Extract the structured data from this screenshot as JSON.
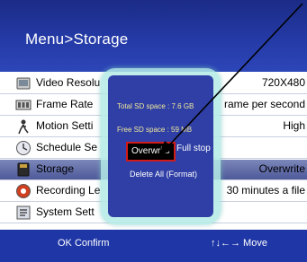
{
  "header": {
    "title": "Menu>Storage"
  },
  "menu": {
    "rows": [
      {
        "label": "Video Resolu",
        "value": "720X480"
      },
      {
        "label": "Frame Rate",
        "value": "rame per second"
      },
      {
        "label": "Motion Setti",
        "value": "High"
      },
      {
        "label": "Schedule Se",
        "value": ""
      },
      {
        "label": "Storage",
        "value": "Overwrite"
      },
      {
        "label": "Recording Le",
        "value": "30 minutes a file"
      },
      {
        "label": "System Sett",
        "value": ""
      }
    ],
    "selected_index": 4
  },
  "popup": {
    "total_sd_space": "Total SD space : 7.6 GB",
    "free_sd_space": "Free SD space : 59 MB",
    "option_overwrite": "Overwrite",
    "or_text": "or",
    "option_full_stop": "Full stop",
    "delete_all": "Delete All (Format)"
  },
  "footer": {
    "confirm": "OK Confirm",
    "move": "↑↓←→ Move"
  },
  "colors": {
    "header_blue": "#243aa6",
    "footer_blue": "#1f36a6",
    "popup_blue": "#2f3fa6",
    "highlight_red": "#d11a1a"
  },
  "icons": [
    "video-icon",
    "frame-rate-icon",
    "motion-icon",
    "schedule-icon",
    "storage-icon",
    "recording-icon",
    "system-icon"
  ]
}
